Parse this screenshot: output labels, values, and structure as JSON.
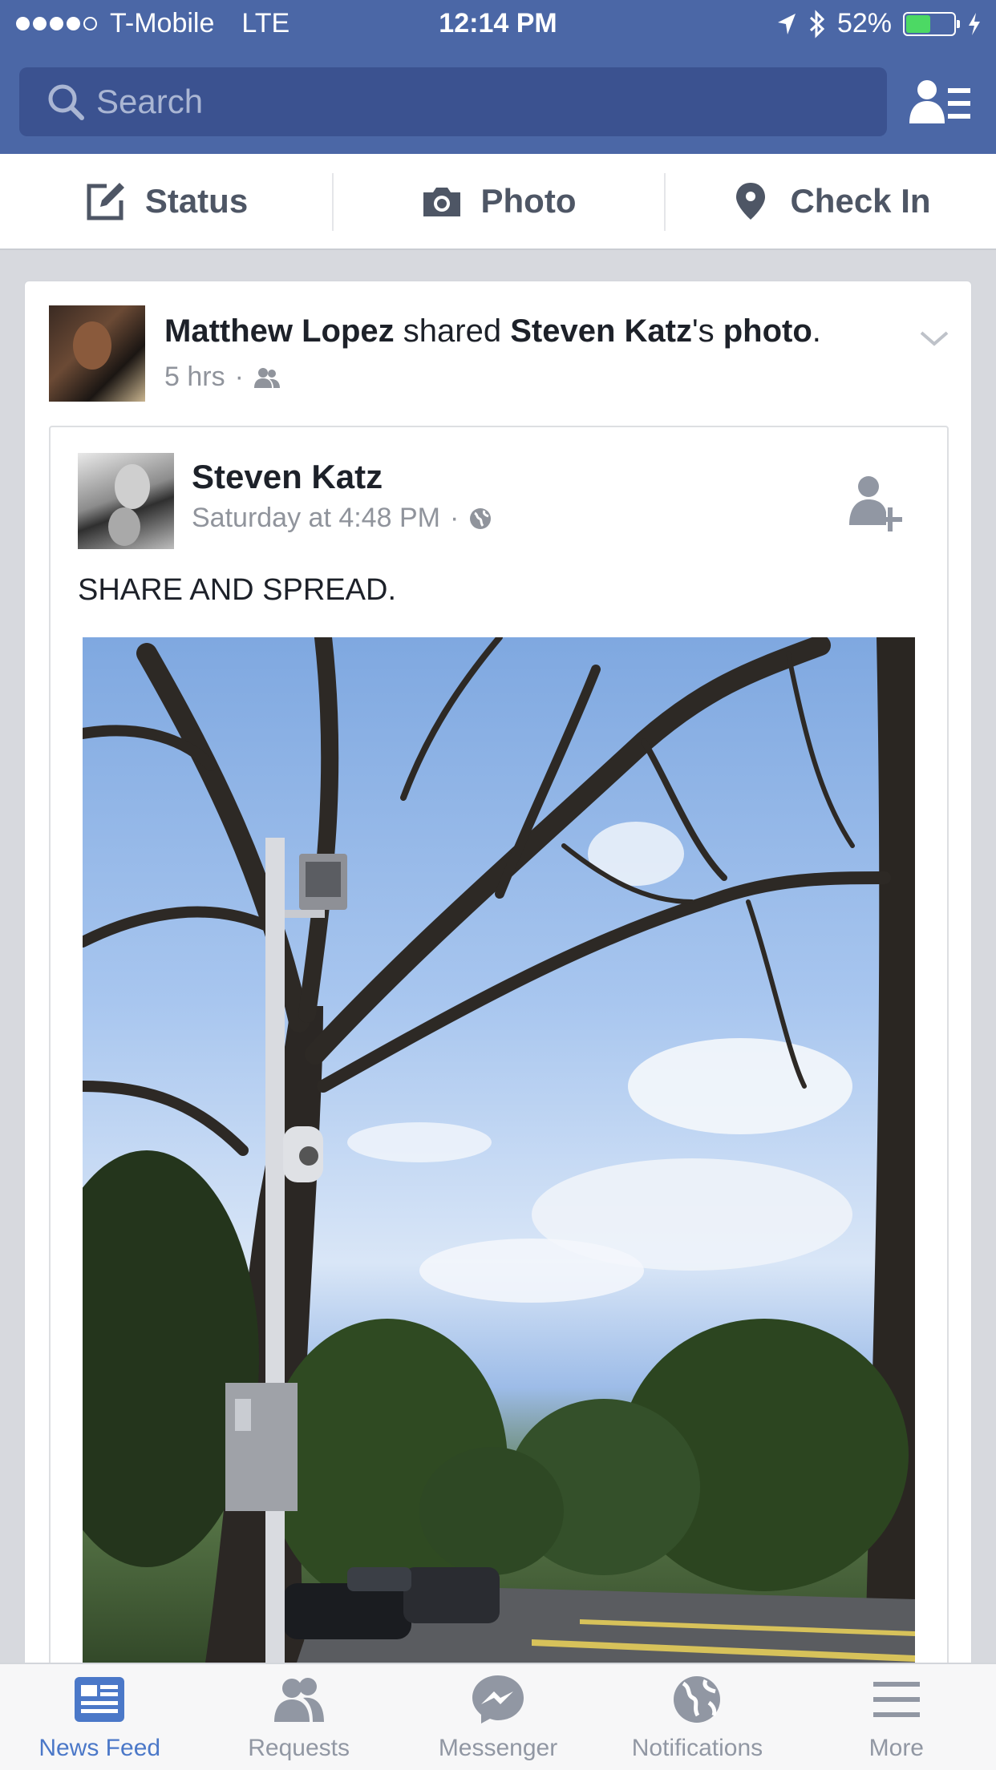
{
  "status_bar": {
    "carrier": "T-Mobile",
    "network": "LTE",
    "time": "12:14 PM",
    "battery": "52%",
    "battery_level": 0.52
  },
  "search": {
    "placeholder": "Search"
  },
  "composer": {
    "status_label": "Status",
    "photo_label": "Photo",
    "checkin_label": "Check In"
  },
  "story": {
    "actor": "Matthew Lopez",
    "verb": " shared ",
    "owner": "Steven Katz",
    "possessive": "'s ",
    "object": "photo",
    "period": ".",
    "time": "5 hrs",
    "separator": "·"
  },
  "shared_post": {
    "author": "Steven Katz",
    "time": "Saturday at 4:48 PM",
    "separator": "·",
    "text": "SHARE AND SPREAD."
  },
  "tabbar": {
    "items": [
      {
        "label": "News Feed",
        "icon": "news-feed-icon",
        "active": true
      },
      {
        "label": "Requests",
        "icon": "friend-requests-icon",
        "active": false
      },
      {
        "label": "Messenger",
        "icon": "messenger-icon",
        "active": false
      },
      {
        "label": "Notifications",
        "icon": "globe-icon",
        "active": false
      },
      {
        "label": "More",
        "icon": "menu-icon",
        "active": false
      }
    ]
  },
  "colors": {
    "brand": "#4b67a6",
    "active_tab": "#4b78c8",
    "muted": "#90949c"
  }
}
